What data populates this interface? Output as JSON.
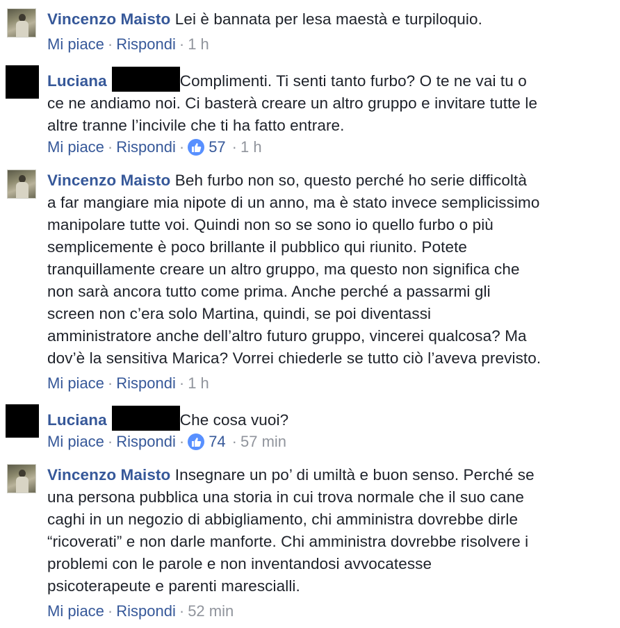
{
  "comments": [
    {
      "author": "Vincenzo Maisto",
      "lines": [
        "Lei è bannata per lesa maestà e turpiloquio."
      ],
      "like_label": "Mi piace",
      "reply_label": "Rispondi",
      "time": "1 h"
    },
    {
      "author": "Luciana",
      "lines": [
        "Complimenti. Ti senti tanto furbo? O te ne vai tu o",
        "ce ne andiamo noi. Ci basterà creare un altro gruppo e invitare tutte le",
        "altre tranne l’incivile che ti ha fatto entrare."
      ],
      "like_label": "Mi piace",
      "reply_label": "Rispondi",
      "reaction_count": "57",
      "time": "1 h"
    },
    {
      "author": "Vincenzo Maisto",
      "lines": [
        "Beh furbo non so, questo perché ho serie difficoltà",
        "a far mangiare mia nipote di un anno, ma è stato invece semplicissimo",
        "manipolare tutte voi. Quindi non so se sono io quello furbo o più",
        "semplicemente è poco brillante il pubblico qui riunito. Potete",
        "tranquillamente creare un altro gruppo, ma questo non significa che",
        "non sarà ancora tutto come prima. Anche perché a passarmi gli",
        "screen non c’era solo Martina, quindi, se poi diventassi",
        "amministratore anche dell’altro futuro gruppo, vincerei qualcosa? Ma",
        "dov’è la sensitiva Marica? Vorrei chiederle se tutto ciò l’aveva previsto."
      ],
      "like_label": "Mi piace",
      "reply_label": "Rispondi",
      "time": "1 h"
    },
    {
      "author": "Luciana",
      "lines": [
        "Che cosa vuoi?"
      ],
      "like_label": "Mi piace",
      "reply_label": "Rispondi",
      "reaction_count": "74",
      "time": "57 min"
    },
    {
      "author": "Vincenzo Maisto",
      "lines": [
        "Insegnare un po’ di umiltà e buon senso. Perché se",
        "una persona pubblica una storia in cui trova normale che il suo cane",
        "caghi in un negozio di abbigliamento, chi amministra dovrebbe dirle",
        "“ricoverati” e non darle manforte. Chi amministra dovrebbe risolvere i",
        "problemi con le parole e non inventandosi avvocatesse",
        "psicoterapeute e parenti marescialli."
      ],
      "like_label": "Mi piace",
      "reply_label": "Rispondi",
      "time": "52 min"
    }
  ],
  "separator": "·",
  "colors": {
    "link": "#365899",
    "text": "#1d2129",
    "muted": "#90949c",
    "like_badge": "#5890ff"
  },
  "icons": {
    "like": "thumbs-up-icon"
  }
}
